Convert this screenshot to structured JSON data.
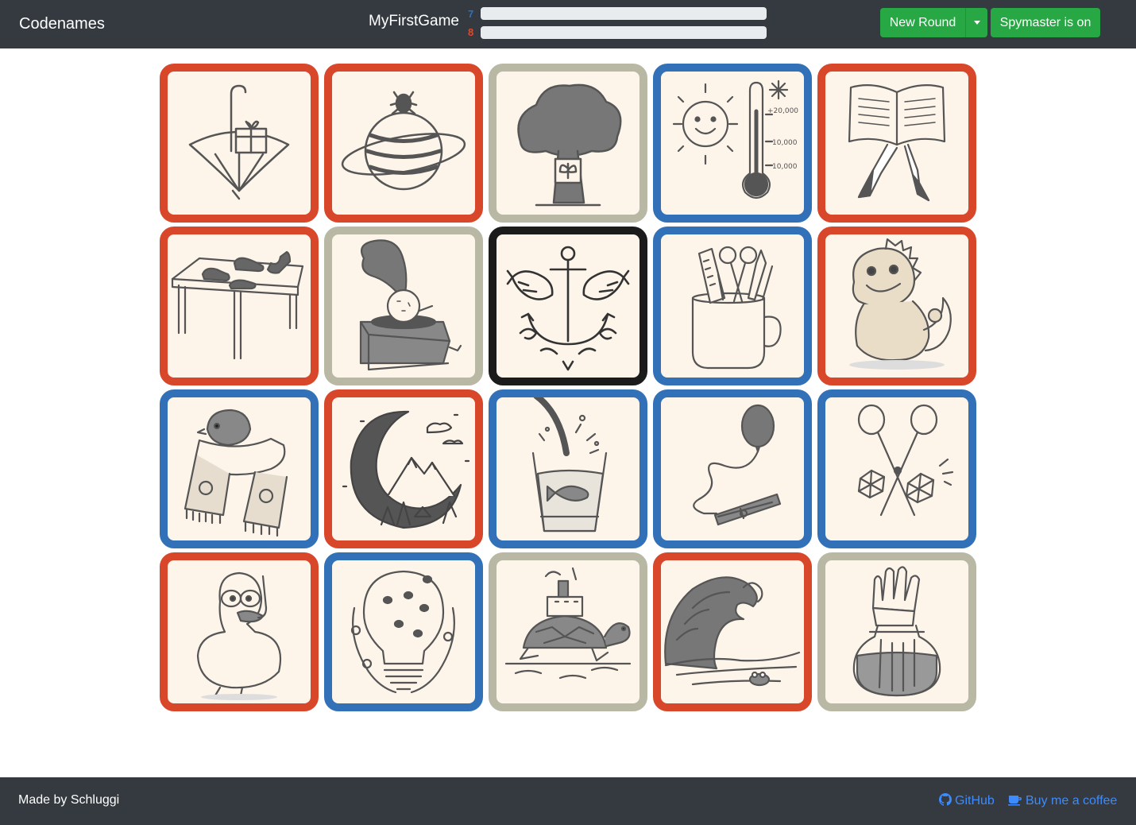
{
  "app": {
    "title": "Codenames"
  },
  "game": {
    "name": "MyFirstGame"
  },
  "scores": {
    "blue_remaining": "7",
    "red_remaining": "8",
    "blue_progress": 0,
    "red_progress": 0
  },
  "toolbar": {
    "new_round_label": "New Round",
    "spymaster_label": "Spymaster is on"
  },
  "colors": {
    "red": "#d9472b",
    "blue": "#3271b7",
    "neutral": "#b8b8a4",
    "assassin": "#1b1b1b",
    "nav": "#343a40",
    "button": "#28a745"
  },
  "cards": [
    {
      "team": "red",
      "icon": "umbrella-gift-icon"
    },
    {
      "team": "red",
      "icon": "planet-beetle-icon"
    },
    {
      "team": "neutral",
      "icon": "tree-butterfly-icon"
    },
    {
      "team": "blue",
      "icon": "sun-thermometer-icon"
    },
    {
      "team": "red",
      "icon": "book-legs-icon"
    },
    {
      "team": "red",
      "icon": "table-shoes-icon"
    },
    {
      "team": "neutral",
      "icon": "gramophone-icon"
    },
    {
      "team": "assassin",
      "icon": "anchor-fish-icon"
    },
    {
      "team": "blue",
      "icon": "mug-scissors-icon"
    },
    {
      "team": "red",
      "icon": "baby-dragon-icon"
    },
    {
      "team": "blue",
      "icon": "bird-scarf-icon"
    },
    {
      "team": "red",
      "icon": "moon-mountains-icon"
    },
    {
      "team": "blue",
      "icon": "glass-fish-icon"
    },
    {
      "team": "blue",
      "icon": "balloon-clothespin-icon"
    },
    {
      "team": "blue",
      "icon": "scissors-diamonds-icon"
    },
    {
      "team": "red",
      "icon": "duck-snorkel-icon"
    },
    {
      "team": "blue",
      "icon": "lightbulb-bees-icon"
    },
    {
      "team": "neutral",
      "icon": "turtle-ship-icon"
    },
    {
      "team": "red",
      "icon": "wave-frog-icon"
    },
    {
      "team": "neutral",
      "icon": "glove-jar-icon"
    }
  ],
  "footer": {
    "credit": "Made by Schluggi",
    "github_label": "GitHub",
    "coffee_label": "Buy me a coffee"
  }
}
